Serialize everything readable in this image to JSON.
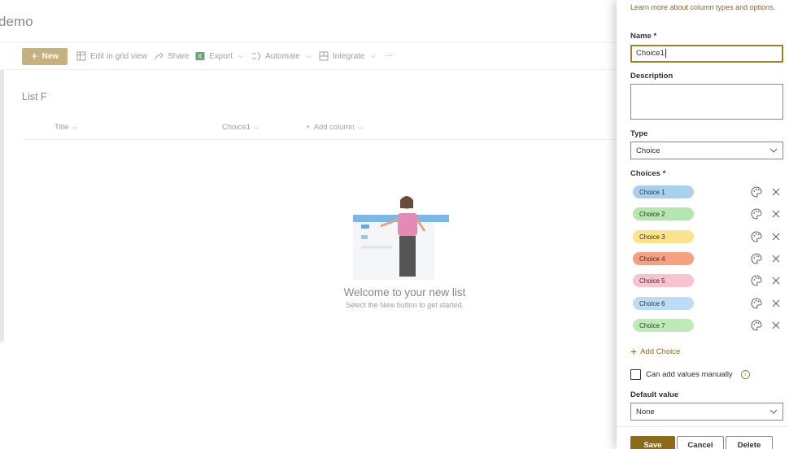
{
  "site": {
    "title": "demo",
    "list_name": "List F",
    "commands": {
      "new": "New",
      "edit_grid": "Edit in grid view",
      "share": "Share",
      "export": "Export",
      "automate": "Automate",
      "integrate": "Integrate",
      "more": "···"
    },
    "columns": [
      "Title",
      "Choice1",
      "Add column"
    ],
    "empty_title": "Welcome to your new list",
    "empty_subtitle": "Select the New button to get started."
  },
  "panel": {
    "learn_more": "Learn more about column types and options.",
    "name_label": "Name *",
    "name_value": "Choice1",
    "description_label": "Description",
    "type_label": "Type",
    "type_value": "Choice",
    "choices_label": "Choices *",
    "choices": [
      {
        "label": "Choice 1",
        "color": "#a8d1f0"
      },
      {
        "label": "Choice 2",
        "color": "#b5e6b0"
      },
      {
        "label": "Choice 3",
        "color": "#fbe28c"
      },
      {
        "label": "Choice 4",
        "color": "#f5a07e"
      },
      {
        "label": "Choice 5",
        "color": "#f8c3cf"
      },
      {
        "label": "Choice 6",
        "color": "#bcdcf5"
      },
      {
        "label": "Choice 7",
        "color": "#bfeab8"
      }
    ],
    "add_choice": "Add Choice",
    "manual_values": "Can add values manually",
    "default_label": "Default value",
    "default_value": "None",
    "save": "Save",
    "cancel": "Cancel",
    "delete": "Delete"
  },
  "colors": {
    "accent": "#8b6a1b",
    "new_button": "#c7b07f"
  }
}
